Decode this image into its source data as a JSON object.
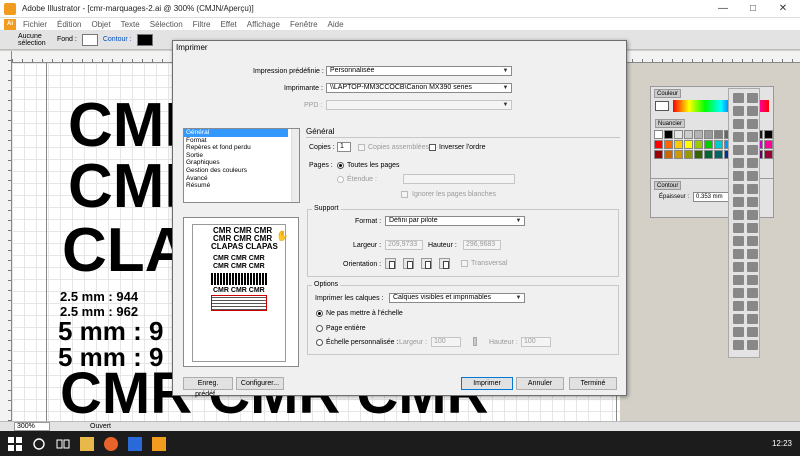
{
  "window": {
    "title": "Adobe Illustrator - [cmr-marquages-2.ai @ 300% (CMJN/Aperçu)]",
    "minimize": "—",
    "maximize": "□",
    "close": "✕"
  },
  "menu": [
    "Fichier",
    "Édition",
    "Objet",
    "Texte",
    "Sélection",
    "Filtre",
    "Effet",
    "Affichage",
    "Fenêtre",
    "Aide"
  ],
  "control_bar": {
    "selection": "Aucune sélection",
    "fill": "Fond :",
    "stroke": "Contour :"
  },
  "canvas_text": {
    "line1": "CMR",
    "line2": "CMR",
    "line3": "CLA",
    "line4": "2.5 mm : 944",
    "line4b": "944",
    "line5": "2.5 mm : 962",
    "line5b": "962",
    "line6": "5 mm : 9",
    "line7": "5 mm : 9",
    "line8": "CMR CMR CMR"
  },
  "status": {
    "zoom": "300%",
    "text": "Ouvert"
  },
  "dialog": {
    "title": "Imprimer",
    "preset_label": "Impression prédéfinie :",
    "preset_value": "Personnalisée",
    "printer_label": "Imprimante :",
    "printer_value": "\\\\LAPTOP-MM3CCOCB\\Canon MX390 series",
    "ppd_label": "PPD :",
    "categories": [
      "Général",
      "Format",
      "Repères et fond perdu",
      "Sortie",
      "Graphiques",
      "Gestion des couleurs",
      "Avancé",
      "Résumé"
    ],
    "section_title": "Général",
    "copies_label": "Copies :",
    "copies_value": "1",
    "collate_label": "Copies assemblées",
    "reverse_label": "Inverser l'ordre",
    "pages_label": "Pages :",
    "all_pages": "Toutes les pages",
    "range_label": "Étendue :",
    "ignore_blank": "Ignorer les pages blanches",
    "support_title": "Support",
    "format_label": "Format :",
    "format_value": "Défini par pilote",
    "width_label": "Largeur :",
    "width_value": "209,9733",
    "height_label": "Hauteur :",
    "height_value": "296,9683",
    "orientation_label": "Orientation :",
    "transversal_label": "Transversal",
    "options_title": "Options",
    "layers_label": "Imprimer les calques :",
    "layers_value": "Calques visibles et imprimables",
    "no_scale": "Ne pas mettre à l'échelle",
    "fit_page": "Page entière",
    "custom_scale": "Échelle personnalisée :",
    "scale_width_label": "Largeur :",
    "scale_width_value": "100",
    "scale_height_label": "Hauteur :",
    "scale_height_value": "100",
    "save_preset": "Enreg. prédéf...",
    "setup": "Configurer...",
    "print": "Imprimer",
    "cancel": "Annuler",
    "done": "Terminé",
    "preview_lines": [
      "CMR CMR CMR",
      "CMR CMR CMR",
      "CLAPAS CLAPAS",
      "CMR CMR CMR",
      "CMR CMR CMR",
      "CMR CMR CMR"
    ]
  },
  "panels": {
    "color_tab": "Couleur",
    "swatches_tab": "Nuancier",
    "stroke_tab": "Contour",
    "stroke_weight_label": "Épaisseur :",
    "stroke_weight_value": "0.353 mm"
  },
  "taskbar": {
    "time": "12:23"
  },
  "swatch_colors": [
    "#ffffff",
    "#000000",
    "#e6e6e6",
    "#cccccc",
    "#b3b3b3",
    "#999999",
    "#808080",
    "#666666",
    "#4d4d4d",
    "#333333",
    "#1a1a1a",
    "#000000",
    "#ff0000",
    "#ff6600",
    "#ffcc00",
    "#ffff00",
    "#99cc00",
    "#00cc00",
    "#00cccc",
    "#0099ff",
    "#0033cc",
    "#6600cc",
    "#cc00cc",
    "#ff0099",
    "#990000",
    "#cc6600",
    "#cc9900",
    "#999900",
    "#336600",
    "#006633",
    "#006666",
    "#003399",
    "#000066",
    "#330066",
    "#660066",
    "#990033"
  ]
}
